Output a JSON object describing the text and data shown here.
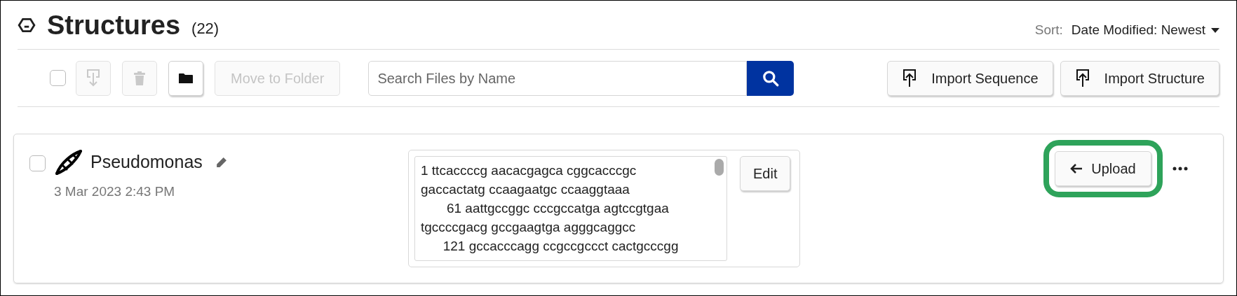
{
  "header": {
    "title": "Structures",
    "count": "(22)",
    "sort_label": "Sort:",
    "sort_value": "Date Modified: Newest"
  },
  "toolbar": {
    "select_all": {
      "checked": false
    },
    "actions": [
      {
        "kind": "download",
        "disabled": true
      },
      {
        "kind": "delete",
        "disabled": true
      },
      {
        "kind": "folder",
        "disabled": false
      },
      {
        "kind": "text",
        "label": "Move to Folder",
        "disabled": true
      }
    ],
    "search": {
      "placeholder": "Search Files by Name"
    },
    "imports": [
      "Import Sequence",
      "Import Structure"
    ]
  },
  "files": [
    {
      "checked": false,
      "name": "Pseudomonas",
      "date": "3 Mar 2023 2:43 PM",
      "sequence": [
        "1 ttcaccccg aacacgagca cggcacccgc",
        "gaccactatg ccaagaatgc ccaaggtaaa",
        "       61 aattgccggc cccgccatga agtccgtgaa",
        "tgccccgacg gccgaagtga agggcaggcc",
        "      121 gccacccagg ccgccgccct cactgcccgg"
      ],
      "edit": "Edit",
      "upload": {
        "label": "Upload",
        "highlighted": true
      }
    }
  ]
}
